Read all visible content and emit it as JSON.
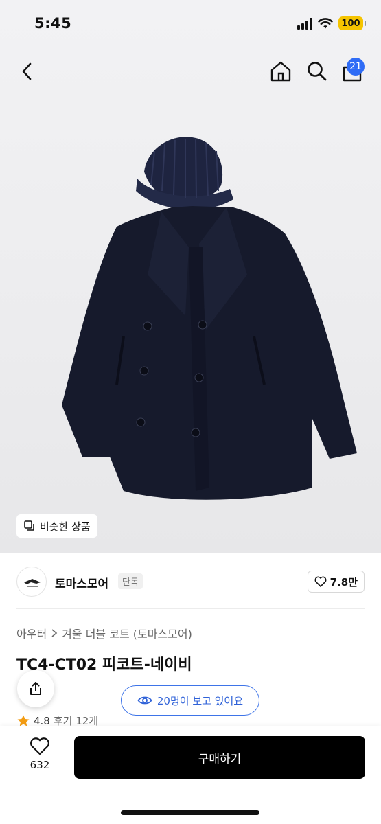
{
  "status_bar": {
    "time": "5:45",
    "battery": "100"
  },
  "nav": {
    "cart_count": "21"
  },
  "hero": {
    "similar_label": "비슷한 상품"
  },
  "seller": {
    "name": "토마스모어",
    "tag": "단독",
    "likes": "7.8만"
  },
  "breadcrumb": {
    "category": "아우터",
    "subcategory": "겨울 더블 코트 (토마스모어)"
  },
  "product": {
    "title": "TC4-CT02 피코트-네이비"
  },
  "viewers": {
    "text": "20명이 보고 있어요"
  },
  "rating": {
    "score": "4.8",
    "reviews": "후기 12개"
  },
  "bottom": {
    "wish_count": "632",
    "buy_label": "구매하기"
  },
  "colors": {
    "accent": "#2f6cf6",
    "buy": "#000000",
    "star": "#f39c12",
    "battery": "#f5c400"
  },
  "icons": [
    "back-icon",
    "home-icon",
    "search-icon",
    "cart-icon",
    "copy-icon",
    "heart-icon",
    "share-icon",
    "eye-icon",
    "star-icon",
    "chevron-right-icon"
  ]
}
